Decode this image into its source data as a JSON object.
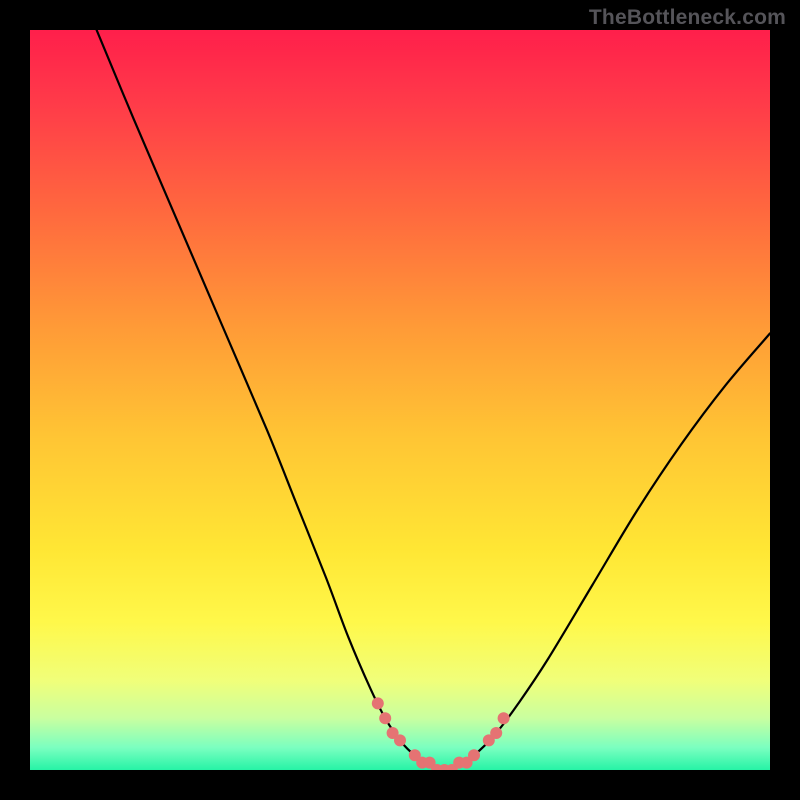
{
  "watermark": {
    "text": "TheBottleneck.com"
  },
  "colors": {
    "black": "#000000",
    "curve": "#000000",
    "marker": "#e57373",
    "gradient_stops": [
      {
        "offset": 0.0,
        "color": "#ff1f4b"
      },
      {
        "offset": 0.1,
        "color": "#ff3b49"
      },
      {
        "offset": 0.25,
        "color": "#ff6a3e"
      },
      {
        "offset": 0.4,
        "color": "#ff9a37"
      },
      {
        "offset": 0.55,
        "color": "#ffc534"
      },
      {
        "offset": 0.7,
        "color": "#ffe634"
      },
      {
        "offset": 0.8,
        "color": "#fff84a"
      },
      {
        "offset": 0.88,
        "color": "#f0ff7a"
      },
      {
        "offset": 0.93,
        "color": "#c9ffa0"
      },
      {
        "offset": 0.97,
        "color": "#7affc0"
      },
      {
        "offset": 1.0,
        "color": "#26f3a6"
      }
    ]
  },
  "chart_data": {
    "type": "line",
    "title": "",
    "xlabel": "",
    "ylabel": "",
    "xlim": [
      0,
      100
    ],
    "ylim": [
      0,
      100
    ],
    "series": [
      {
        "name": "bottleneck-curve",
        "x": [
          9,
          14,
          20,
          26,
          32,
          36,
          40,
          43,
          46,
          48,
          50,
          52,
          54,
          55,
          56,
          57,
          58,
          60,
          63,
          66,
          70,
          76,
          82,
          88,
          94,
          100
        ],
        "y": [
          100,
          88,
          74,
          60,
          46,
          36,
          26,
          18,
          11,
          7,
          4,
          2,
          1,
          0,
          0,
          0,
          1,
          2,
          5,
          9,
          15,
          25,
          35,
          44,
          52,
          59
        ]
      }
    ],
    "markers": {
      "name": "highlight-points",
      "x": [
        47,
        48,
        49,
        50,
        52,
        53,
        54,
        55,
        56,
        57,
        58,
        59,
        60,
        62,
        63,
        64
      ],
      "y": [
        9,
        7,
        5,
        4,
        2,
        1,
        1,
        0,
        0,
        0,
        1,
        1,
        2,
        4,
        5,
        7
      ]
    }
  }
}
